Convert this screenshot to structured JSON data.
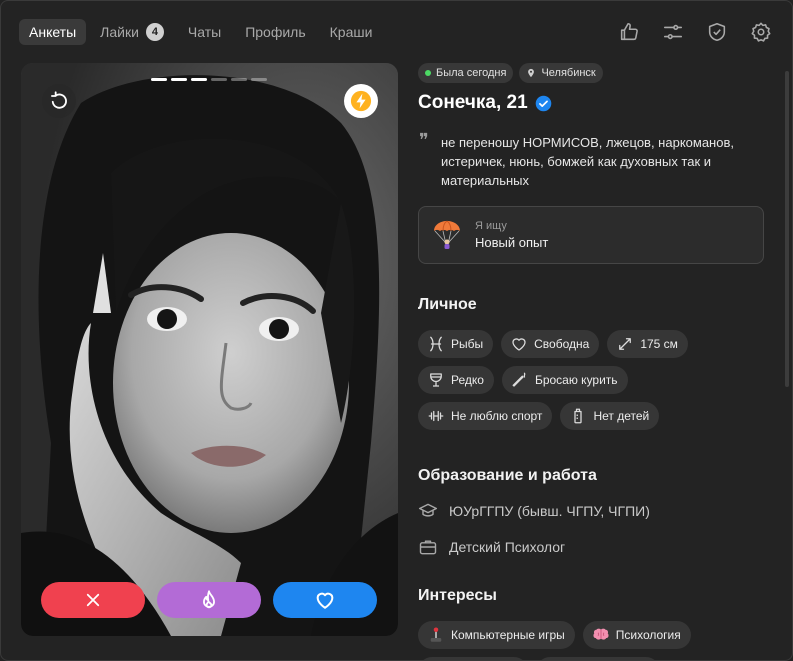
{
  "nav": {
    "tabs": [
      {
        "label": "Анкеты",
        "active": true
      },
      {
        "label": "Лайки",
        "badge": "4"
      },
      {
        "label": "Чаты"
      },
      {
        "label": "Профиль"
      },
      {
        "label": "Краши"
      }
    ],
    "icons": [
      "thumbs-up-icon",
      "sliders-icon",
      "shield-check-icon",
      "gear-icon"
    ]
  },
  "photo": {
    "progress": {
      "total": 6,
      "current": 3
    },
    "colors": {
      "dislike": "#f0414f",
      "super": "#b36bd6",
      "like": "#1e86f0"
    }
  },
  "profile": {
    "status": "Была сегодня",
    "city": "Челябинск",
    "name": "Сонечка, 21",
    "verified": true,
    "bio": "не переношу НОРМИСОВ, лжецов, наркоманов, истеричек, нюнь, бомжей как духовных так и материальных",
    "looking": {
      "label": "Я ищу",
      "value": "Новый опыт"
    }
  },
  "personal": {
    "title": "Личное",
    "chips": [
      {
        "icon": "pisces-icon",
        "label": "Рыбы"
      },
      {
        "icon": "heart-outline-icon",
        "label": "Свободна"
      },
      {
        "icon": "height-icon",
        "label": "175 см"
      },
      {
        "icon": "glass-icon",
        "label": "Редко"
      },
      {
        "icon": "cigarette-icon",
        "label": "Бросаю курить"
      },
      {
        "icon": "dumbbell-icon",
        "label": "Не люблю спорт"
      },
      {
        "icon": "baby-bottle-icon",
        "label": "Нет детей"
      }
    ]
  },
  "education": {
    "title": "Образование и работа",
    "school": "ЮУрГГПУ (бывш. ЧГПУ, ЧГПИ)",
    "job": "Детский Психолог"
  },
  "interests": {
    "title": "Интересы",
    "chips": [
      {
        "icon": "joystick-icon",
        "label": "Компьютерные игры"
      },
      {
        "icon": "brain-icon",
        "label": "Психология"
      }
    ]
  }
}
